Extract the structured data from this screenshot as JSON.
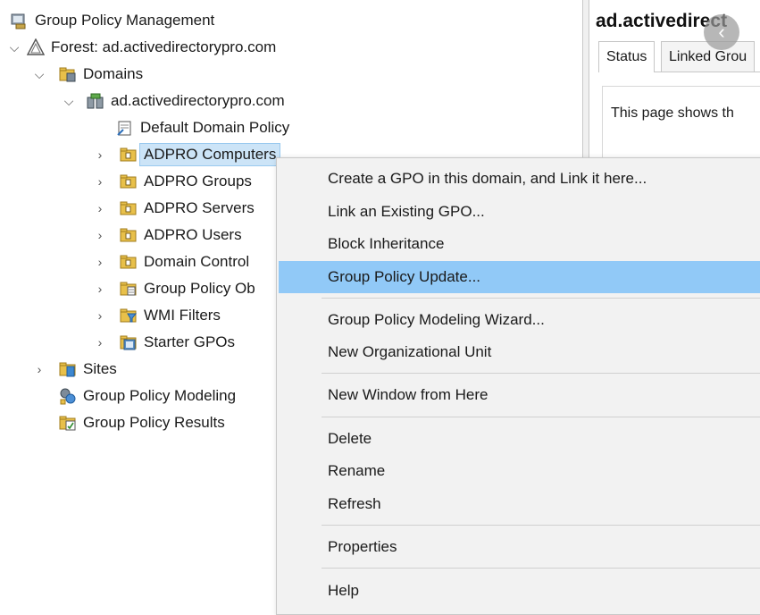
{
  "tree": {
    "root": {
      "label": "Group Policy Management",
      "icon": "gpm-console-icon"
    },
    "forest": {
      "label": "Forest: ad.activedirectorypro.com",
      "icon": "forest-icon"
    },
    "domains": {
      "label": "Domains",
      "icon": "domains-folder-icon"
    },
    "domain": {
      "label": "ad.activedirectorypro.com",
      "icon": "domain-icon"
    },
    "default_policy": {
      "label": "Default Domain Policy",
      "icon": "gpo-link-icon"
    },
    "ous": [
      {
        "label": "ADPRO Computers",
        "icon": "ou-folder-icon",
        "selected": true
      },
      {
        "label": "ADPRO Groups",
        "icon": "ou-folder-icon"
      },
      {
        "label": "ADPRO Servers",
        "icon": "ou-folder-icon"
      },
      {
        "label": "ADPRO Users",
        "icon": "ou-folder-icon"
      },
      {
        "label": "Domain Control",
        "icon": "ou-folder-icon"
      },
      {
        "label": "Group Policy Ob",
        "icon": "gpo-folder-icon"
      },
      {
        "label": "WMI Filters",
        "icon": "wmi-folder-icon"
      },
      {
        "label": "Starter GPOs",
        "icon": "starter-gpo-icon"
      }
    ],
    "sites": {
      "label": "Sites",
      "icon": "sites-icon"
    },
    "modeling": {
      "label": "Group Policy Modeling",
      "icon": "modeling-icon"
    },
    "results": {
      "label": "Group Policy Results",
      "icon": "results-icon"
    }
  },
  "detail": {
    "title": "ad.activedirect",
    "tabs": [
      "Status",
      "Linked Grou"
    ],
    "text": "This page shows th",
    "back_glyph": "‹"
  },
  "context_menu": {
    "items": [
      {
        "label": "Create a GPO in this domain, and Link it here..."
      },
      {
        "label": "Link an Existing GPO..."
      },
      {
        "label": "Block Inheritance"
      },
      {
        "label": "Group Policy Update...",
        "highlighted": true
      },
      {
        "label": "Group Policy Modeling Wizard..."
      },
      {
        "label": "New Organizational Unit"
      },
      {
        "label": "New Window from Here"
      },
      {
        "label": "Delete"
      },
      {
        "label": "Rename"
      },
      {
        "label": "Refresh"
      },
      {
        "label": "Properties"
      },
      {
        "label": "Help"
      }
    ]
  },
  "colors": {
    "menu_highlight": "#91c9f7",
    "menu_background": "#f2f2f2",
    "tree_selection": "#cce4f7",
    "folder_yellow": "#e8c04a"
  }
}
